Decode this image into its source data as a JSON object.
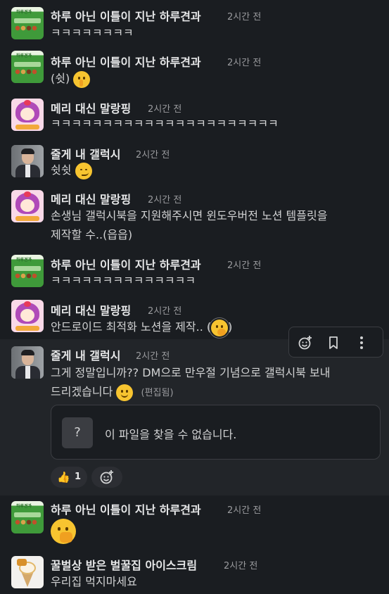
{
  "messages": [
    {
      "user": "하루 아닌 이틀이 지난 하루견과",
      "time": "2시간 전",
      "text": "ㅋㅋㅋㅋㅋㅋㅋㅋ",
      "avatar": "nut-snack-avatar"
    },
    {
      "user": "하루 아닌 이틀이 지난 하루견과",
      "time": "2시간 전",
      "text": "(쉿)",
      "emoji": "shushing-face-emoji"
    },
    {
      "user": "메리 대신 말랑핑",
      "time": "2시간 전",
      "text": "ㅋㅋㅋㅋㅋㅋㅋㅋㅋㅋㅋㅋㅋㅋㅋㅋㅋㅋㅋㅋㅋㅋ"
    },
    {
      "user": "줄게 내 갤럭시",
      "time": "2시간 전",
      "text": "쉿쉿",
      "emoji": "smirking-face-emoji"
    },
    {
      "user": "메리 대신 말랑핑",
      "time": "2시간 전",
      "text_line1": "손생님 갤럭시북을 지원해주시면 윈도우버전 노션 템플릿을",
      "text_line2": "제작할 수..(읍읍)"
    },
    {
      "user": "하루 아닌 이틀이 지난 하루견과",
      "time": "2시간 전",
      "text": "ㅋㅋㅋㅋㅋㅋㅋㅋㅋㅋㅋㅋㅋㅋ"
    },
    {
      "user": "메리 대신 말랑핑",
      "time": "2시간 전",
      "text_before": "안드로이드 최적화 노션을 제작.. (",
      "text_after": ")",
      "emoji": "face-with-hand-over-mouth-emoji"
    },
    {
      "user": "줄게 내 갤럭시",
      "time": "2시간 전",
      "text_line1": "그게 정말입니까?? DM으로 만우절 기념으로 갤럭시북 보내",
      "text_line2": "드리겠습니다",
      "edited": "(편집됨)",
      "emoji": "slightly-smiling-face-emoji",
      "file": {
        "icon": "?",
        "text": "이 파일을 찾을 수 없습니다."
      },
      "reactions": [
        {
          "emoji": "👍",
          "count": "1"
        }
      ]
    },
    {
      "user": "하루 아닌 이틀이 지난 하루견과",
      "time": "2시간 전",
      "emoji": "face-with-hand-over-mouth-emoji"
    },
    {
      "user": "꿀벌상 받은 벌꿀집 아이스크림",
      "time": "2시간 전",
      "text": "우리집 먹지마세요"
    }
  ],
  "toolbar": {
    "add_reaction_icon": "add-reaction-icon",
    "bookmark_icon": "bookmark-icon",
    "more_icon": "more-vertical-icon"
  },
  "add_reaction_glyph": "+",
  "colors": {
    "background": "#1a1d21",
    "highlight": "#222529",
    "text": "#d1d2d3",
    "muted": "#9a9b9e"
  }
}
